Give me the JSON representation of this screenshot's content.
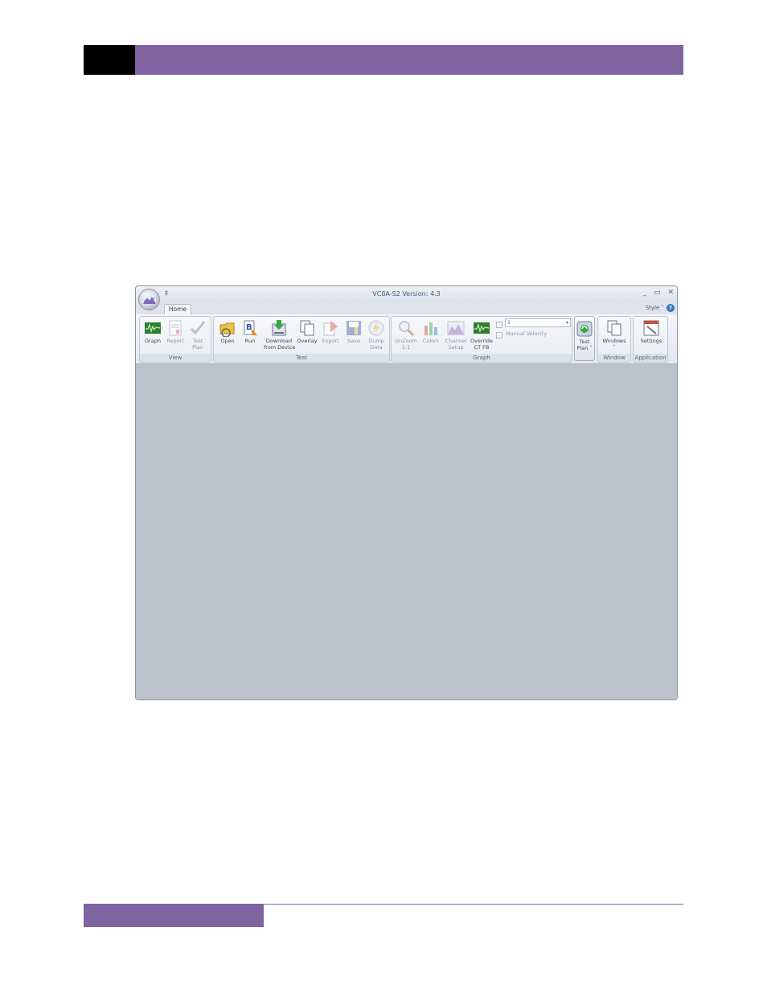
{
  "window": {
    "title": "VC8A-S2 Version: 4.3",
    "qat_label": "‡",
    "min_glyph": "_",
    "max_glyph": "▭",
    "close_glyph": "✕"
  },
  "tabs": [
    {
      "label": "Home"
    }
  ],
  "style_menu": "Style ˇ",
  "help_glyph": "?",
  "groups": {
    "view": {
      "label": "View",
      "buttons": [
        {
          "label": "Graph",
          "icon": "graph-icon",
          "enabled": true
        },
        {
          "label": "Report",
          "icon": "report-icon",
          "enabled": false
        },
        {
          "label": "Test\nPlan",
          "icon": "checkmark-icon",
          "enabled": false
        }
      ]
    },
    "test": {
      "label": "Test",
      "buttons": [
        {
          "label": "Open",
          "icon": "open-icon",
          "enabled": true
        },
        {
          "label": "Run",
          "icon": "run-icon",
          "enabled": true
        },
        {
          "label": "Download\nfrom Device",
          "icon": "download-icon",
          "enabled": true
        },
        {
          "label": "Overlay",
          "icon": "overlay-icon",
          "enabled": true
        },
        {
          "label": "Export",
          "icon": "export-icon",
          "enabled": false
        },
        {
          "label": "Save",
          "icon": "save-icon",
          "enabled": false
        },
        {
          "label": "Dump\nData",
          "icon": "dump-data-icon",
          "enabled": false
        }
      ]
    },
    "graph": {
      "label": "Graph",
      "buttons": [
        {
          "label": "UnZoom\n1:1",
          "icon": "magnifier-icon",
          "enabled": false
        },
        {
          "label": "Colors",
          "icon": "colors-icon",
          "enabled": false
        },
        {
          "label": "Channel\nSetup",
          "icon": "channel-setup-icon",
          "enabled": false
        },
        {
          "label": "Override\nCT FB",
          "icon": "override-icon",
          "enabled": false
        }
      ],
      "combo_value": "1",
      "manual_velocity_label": "Manual Velocity"
    },
    "testplan": {
      "label": "",
      "buttons": [
        {
          "label": "Test\nPlan ˇ",
          "icon": "test-plan-icon",
          "enabled": true
        }
      ]
    },
    "window_group": {
      "label": "Window",
      "buttons": [
        {
          "label": "Windows\nˇ",
          "icon": "windows-icon",
          "enabled": true
        }
      ]
    },
    "application": {
      "label": "Application",
      "buttons": [
        {
          "label": "Settings",
          "icon": "settings-icon",
          "enabled": true
        }
      ]
    }
  },
  "colors": {
    "brand_purple": "#8064a2",
    "workspace": "#bcc1ca",
    "title_text": "#3d5a8a"
  }
}
